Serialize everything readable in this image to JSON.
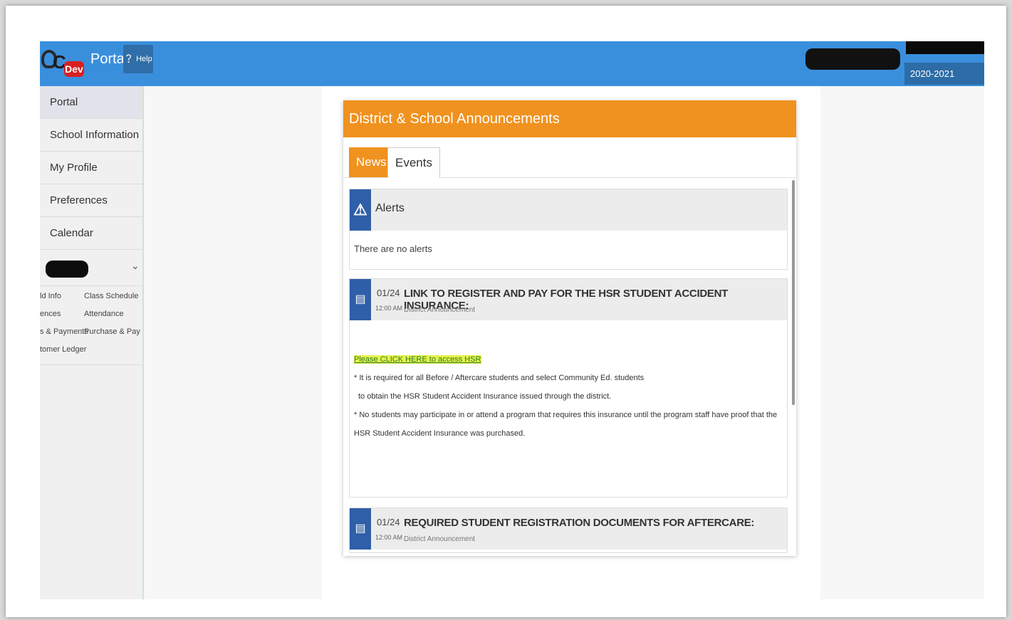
{
  "header": {
    "logo_text": "C",
    "logo_badge": "Dev",
    "brand": "Portal",
    "help_label": "Help",
    "year": "2020-2021"
  },
  "sidebar": {
    "items": [
      {
        "label": "Portal",
        "active": true
      },
      {
        "label": "School Information"
      },
      {
        "label": "My Profile"
      },
      {
        "label": "Preferences"
      },
      {
        "label": "Calendar"
      }
    ],
    "quick_links": [
      "ld Info",
      "Class Schedule",
      "ences",
      "Attendance",
      "s & Payments",
      "Purchase & Pay",
      "tomer Ledger"
    ]
  },
  "announcements": {
    "title": "District & School Announcements",
    "tabs": [
      "News",
      "Events"
    ],
    "alerts": {
      "title": "Alerts",
      "body": "There are no alerts"
    },
    "items": [
      {
        "date": "01/24",
        "time": "12:00 AM",
        "title": "LINK TO REGISTER AND PAY FOR THE HSR STUDENT ACCIDENT INSURANCE:",
        "subtitle": "District Announcement",
        "link": "Please CLICK HERE to access HSR",
        "lines": [
          "* It is required for all Before / Aftercare students and select Community Ed. students",
          "to obtain the HSR Student Accident Insurance issued through the district.",
          "* No students may participate in or attend a program that requires this insurance until the program staff have proof that the HSR Student Accident Insurance was purchased."
        ]
      },
      {
        "date": "01/24",
        "time": "12:00 AM",
        "title": "REQUIRED STUDENT REGISTRATION DOCUMENTS FOR AFTERCARE:",
        "subtitle": "District Announcement"
      }
    ]
  },
  "colors": {
    "topbar": "#3a8fdc",
    "accent_orange": "#f0921f",
    "icon_blue": "#2f5fa8"
  }
}
